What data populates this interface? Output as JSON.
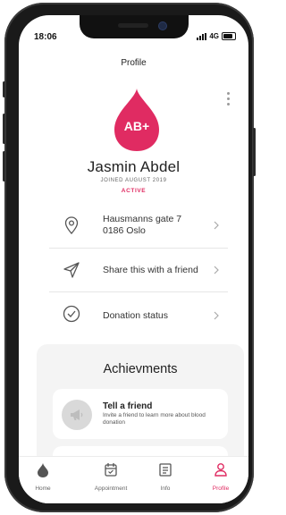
{
  "status_bar": {
    "time": "18:06",
    "network": "4G"
  },
  "header": {
    "title": "Profile"
  },
  "profile": {
    "blood_type": "AB+",
    "name": "Jasmin Abdel",
    "joined": "JOINED AUGUST 2019",
    "status": "ACTIVE"
  },
  "menu": [
    {
      "icon": "location-pin-icon",
      "line1": "Hausmanns gate 7",
      "line2": "0186 Oslo"
    },
    {
      "icon": "paper-plane-icon",
      "label": "Share this with a friend"
    },
    {
      "icon": "check-circle-icon",
      "label": "Donation status"
    }
  ],
  "achievements": {
    "title": "Achievments",
    "cards": [
      {
        "icon": "megaphone-icon",
        "title": "Tell a friend",
        "description": "Invite a friend to learn more about blood donation"
      }
    ]
  },
  "tabs": [
    {
      "icon": "drop-icon",
      "label": "Home"
    },
    {
      "icon": "calendar-check-icon",
      "label": "Appointment"
    },
    {
      "icon": "document-icon",
      "label": "Info"
    },
    {
      "icon": "person-icon",
      "label": "Profile",
      "active": true
    }
  ],
  "colors": {
    "accent": "#e02b62",
    "card_bg": "#f4f4f4"
  }
}
